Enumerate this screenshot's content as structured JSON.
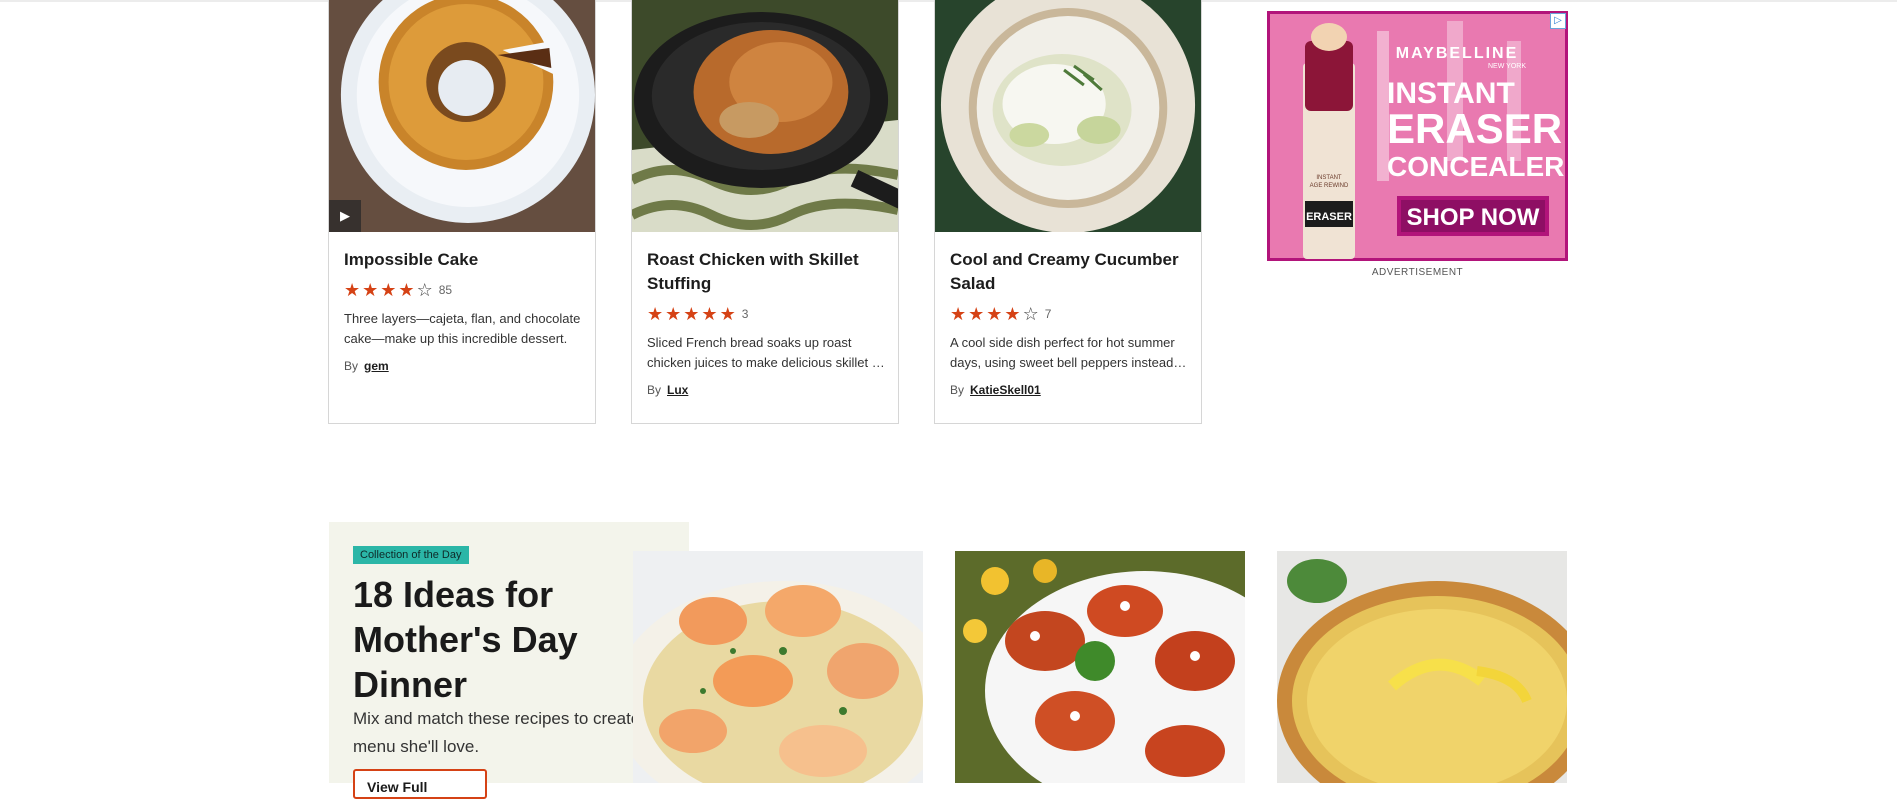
{
  "recipes": [
    {
      "title": "Impossible Cake",
      "rating": 4,
      "rating_count": "85",
      "description_line1": "Three layers—cajeta, flan, and chocolate",
      "description_line2": "cake—make up this incredible dessert.",
      "by_label": "By",
      "author": "gem",
      "has_video": true
    },
    {
      "title": "Roast Chicken with Skillet Stuffing",
      "rating": 5,
      "rating_count": "3",
      "description_line1": "Sliced French bread soaks up roast",
      "description_line2": "chicken juices to make delicious skillet stuffing.",
      "by_label": "By",
      "author": "Lux",
      "has_video": false
    },
    {
      "title": "Cool and Creamy Cucumber Salad",
      "rating": 4,
      "rating_count": "7",
      "description_line1": "A cool side dish perfect for hot summer",
      "description_line2": "days, using sweet bell peppers instead of...",
      "by_label": "By",
      "author": "KatieSkell01",
      "has_video": false
    }
  ],
  "advertisement": {
    "brand": "MAYBELLINE",
    "brand_sub": "NEW YORK",
    "headline_1": "INSTANT",
    "headline_2": "ERASER",
    "headline_3": "CONCEALER",
    "cta": "SHOP NOW",
    "product_text_1": "INSTANT",
    "product_text_2": "AGE REWIND",
    "product_text_3": "ERASER",
    "label": "ADVERTISEMENT",
    "colors": {
      "pink": "#e0559c",
      "magenta": "#b2147a",
      "tube": "#8c1538"
    }
  },
  "collection": {
    "badge": "Collection of the Day",
    "title": "18 Ideas for Mother's Day Dinner",
    "description": "Mix and match these recipes to create a menu she'll love.",
    "button_label": "View Full Collection"
  },
  "colors": {
    "accent": "#d54215",
    "badge": "#2bb6a7",
    "panel": "#f3f4eb"
  }
}
